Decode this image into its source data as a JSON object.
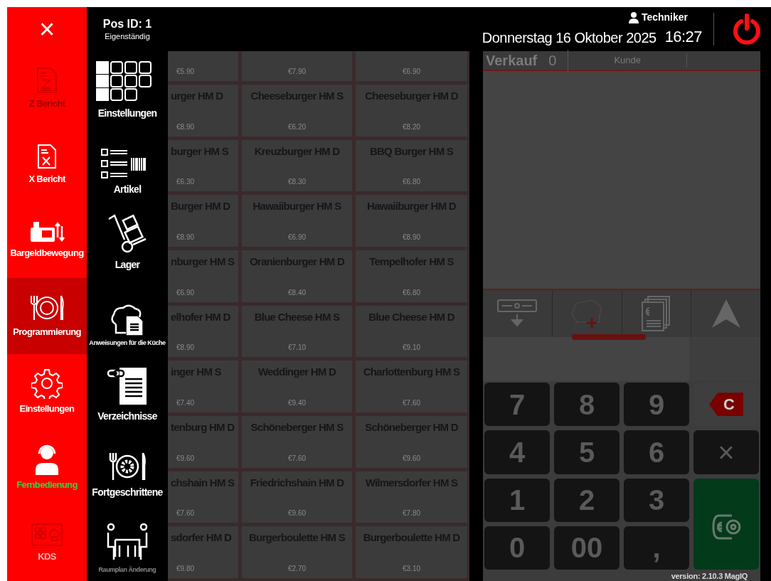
{
  "close_button": {
    "label": "×"
  },
  "pos": {
    "title": "Pos ID: 1",
    "mode": "Eigenständig"
  },
  "main_menu": [
    {
      "label": "Z Bericht",
      "disabled": true,
      "selected": false,
      "highlighted": false
    },
    {
      "label": "X Bericht",
      "disabled": false,
      "selected": false,
      "highlighted": false
    },
    {
      "label": "Bargeldbewegung",
      "disabled": false,
      "selected": false,
      "highlighted": false
    },
    {
      "label": "Programmierung",
      "disabled": false,
      "selected": true,
      "highlighted": false
    },
    {
      "label": "Einstellungen",
      "disabled": false,
      "selected": false,
      "highlighted": false
    },
    {
      "label": "Fernbedienung",
      "disabled": false,
      "selected": false,
      "highlighted": true
    },
    {
      "label": "KDS",
      "disabled": true,
      "selected": false,
      "highlighted": false
    }
  ],
  "sub_menu": [
    {
      "label": "Einstellungen",
      "disabled": false,
      "small": false
    },
    {
      "label": "Artikel",
      "disabled": false,
      "small": false
    },
    {
      "label": "Lager",
      "disabled": false,
      "small": false
    },
    {
      "label": "Anweisungen für die Küche",
      "disabled": false,
      "small": true
    },
    {
      "label": "Verzeichnisse",
      "disabled": false,
      "small": false
    },
    {
      "label": "Fortgeschrittene",
      "disabled": false,
      "small": false
    },
    {
      "label": "Raumplan Änderung",
      "disabled": true,
      "small": true
    }
  ],
  "header": {
    "user": "Techniker",
    "date": "Donnerstag 16 Oktober 2025",
    "time": "16:27"
  },
  "products": [
    [
      {
        "price": "€5.90"
      },
      {
        "price": "€7.90"
      },
      {
        "price": "€6.90"
      }
    ],
    [
      {
        "name": "urger HM D",
        "price": "€8.90"
      },
      {
        "name": "Cheeseburger HM S",
        "price": "€6.20"
      },
      {
        "name": "Cheeseburger HM D",
        "price": "€8.20"
      }
    ],
    [
      {
        "name": "burger HM S",
        "price": "€6.30"
      },
      {
        "name": "Kreuzburger HM D",
        "price": "€8.30"
      },
      {
        "name": "BBQ Burger HM S",
        "price": "€6.80"
      }
    ],
    [
      {
        "name": "Burger HM D",
        "price": "€8.90"
      },
      {
        "name": "Hawaiiburger HM S",
        "price": "€6.90"
      },
      {
        "name": "Hawaiiburger HM D",
        "price": "€8.90"
      }
    ],
    [
      {
        "name": "nburger HM S",
        "price": "€6.90"
      },
      {
        "name": "Oranienburger HM D",
        "price": "€8.40"
      },
      {
        "name": "Tempelhofer HM S",
        "price": "€6.80"
      }
    ],
    [
      {
        "name": "elhofer HM D",
        "price": "€8.90"
      },
      {
        "name": "Blue Cheese HM S",
        "price": "€7.10"
      },
      {
        "name": "Blue Cheese HM D",
        "price": "€9.10"
      }
    ],
    [
      {
        "name": "inger HM S",
        "price": "€7.40"
      },
      {
        "name": "Weddinger HM D",
        "price": "€9.40"
      },
      {
        "name": "Charlottenburg HM S",
        "price": "€7.60"
      }
    ],
    [
      {
        "name": "tenburg HM D",
        "price": "€9.60"
      },
      {
        "name": "Schöneberger HM S",
        "price": "€7.60"
      },
      {
        "name": "Schöneberger HM D",
        "price": "€9.60"
      }
    ],
    [
      {
        "name": "chshain HM S",
        "price": "€7.60"
      },
      {
        "name": "Friedrichshain HM D",
        "price": "€9.60"
      },
      {
        "name": "Wilmersdorfer HM S",
        "price": "€7.80"
      }
    ],
    [
      {
        "name": "sdorfer HM D",
        "price": "€9.80"
      },
      {
        "name": "Burgerboulette HM S",
        "price": "€2.70"
      },
      {
        "name": "Burgerboulette HM D",
        "price": "€3.10"
      }
    ]
  ],
  "order": {
    "tab": "Verkauf",
    "count": "0",
    "customer": "Kunde"
  },
  "keypad": [
    {
      "kind": "digit",
      "label": "7"
    },
    {
      "kind": "digit",
      "label": "8"
    },
    {
      "kind": "digit",
      "label": "9"
    },
    {
      "kind": "clear",
      "label": "C"
    },
    {
      "kind": "digit",
      "label": "4"
    },
    {
      "kind": "digit",
      "label": "5"
    },
    {
      "kind": "digit",
      "label": "6"
    },
    {
      "kind": "multiply",
      "label": "×"
    },
    {
      "kind": "digit",
      "label": "1"
    },
    {
      "kind": "digit",
      "label": "2"
    },
    {
      "kind": "digit",
      "label": "3"
    },
    {
      "kind": "pay"
    },
    {
      "kind": "digit",
      "label": "0"
    },
    {
      "kind": "digit",
      "label": "00"
    },
    {
      "kind": "digit",
      "label": ","
    }
  ],
  "version": "version: 2.10.3 MagIQ"
}
